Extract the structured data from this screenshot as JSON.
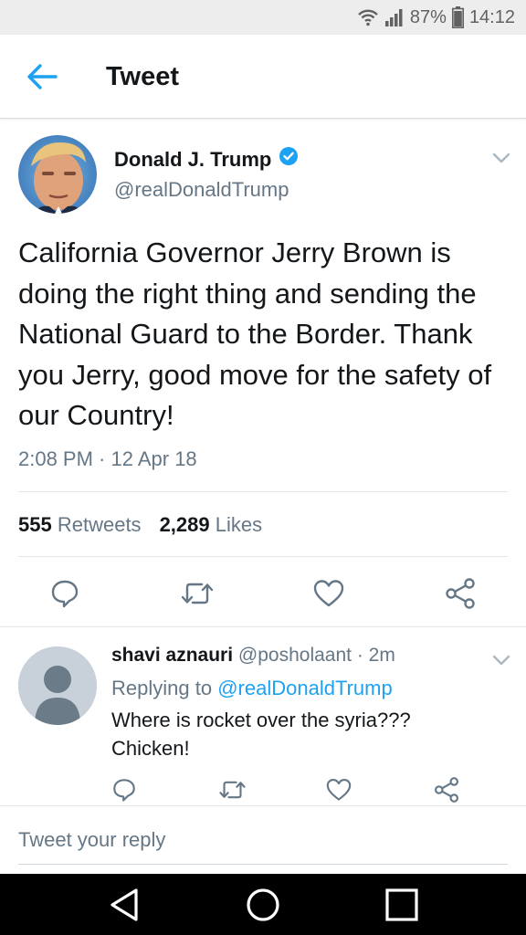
{
  "status_bar": {
    "battery_percent": "87%",
    "time": "14:12",
    "icons": [
      "wifi-icon",
      "signal-icon",
      "battery-icon"
    ]
  },
  "app_bar": {
    "title": "Tweet",
    "back_icon": "back-arrow-icon"
  },
  "tweet": {
    "author_name": "Donald J. Trump",
    "verified": true,
    "handle": "@realDonaldTrump",
    "text": "California Governor Jerry Brown is doing the right thing and sending the National Guard to the Border. Thank you Jerry, good move for the safety of our Country!",
    "timestamp": "2:08 PM · 12 Apr 18",
    "retweet_count": "555",
    "retweets_label": "Retweets",
    "like_count": "2,289",
    "likes_label": "Likes"
  },
  "reply": {
    "author_name": "shavi aznauri",
    "handle": "@posholaant",
    "time": "· 2m",
    "replying_to_label": "Replying to",
    "replying_to_handle": "@realDonaldTrump",
    "text_line1": "Where is rocket over the syria???",
    "text_line2": "Chicken!"
  },
  "compose": {
    "placeholder": "Tweet your reply"
  },
  "colors": {
    "accent": "#1da1f2",
    "text_primary": "#14171a",
    "text_secondary": "#657786",
    "status_bar_bg": "#ededed",
    "nav_bar_bg": "#000000"
  }
}
